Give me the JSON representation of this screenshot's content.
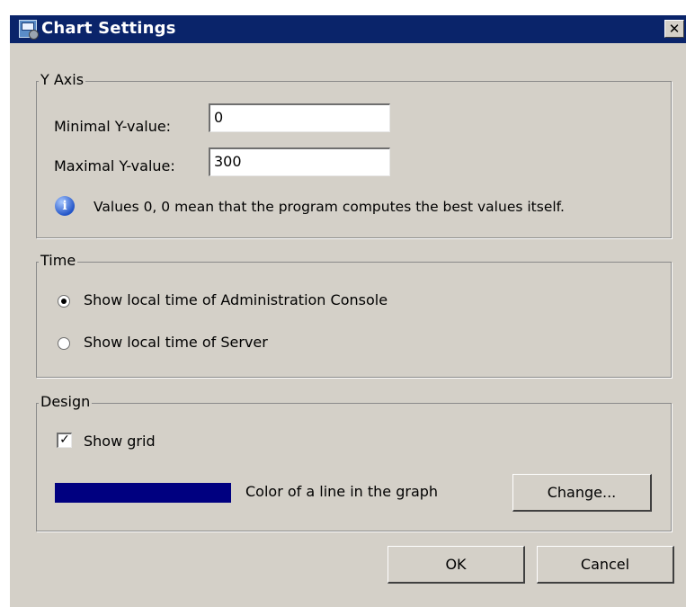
{
  "window": {
    "title": "Chart Settings",
    "close_symbol": "✕"
  },
  "y_axis": {
    "legend": "Y Axis",
    "min_label": "Minimal Y-value:",
    "min_value": "0",
    "max_label": "Maximal Y-value:",
    "max_value": "300",
    "info_symbol": "i",
    "info_text": "Values 0, 0 mean that the program computes the best values itself."
  },
  "time": {
    "legend": "Time",
    "options": [
      {
        "label": "Show local time of Administration Console",
        "selected": true
      },
      {
        "label": "Show local time of Server",
        "selected": false
      }
    ]
  },
  "design": {
    "legend": "Design",
    "show_grid_label": "Show grid",
    "show_grid_checked": true,
    "check_mark": "✓",
    "line_color": "#000080",
    "line_color_label": "Color of a line in the graph",
    "change_label": "Change..."
  },
  "buttons": {
    "ok": "OK",
    "cancel": "Cancel"
  }
}
